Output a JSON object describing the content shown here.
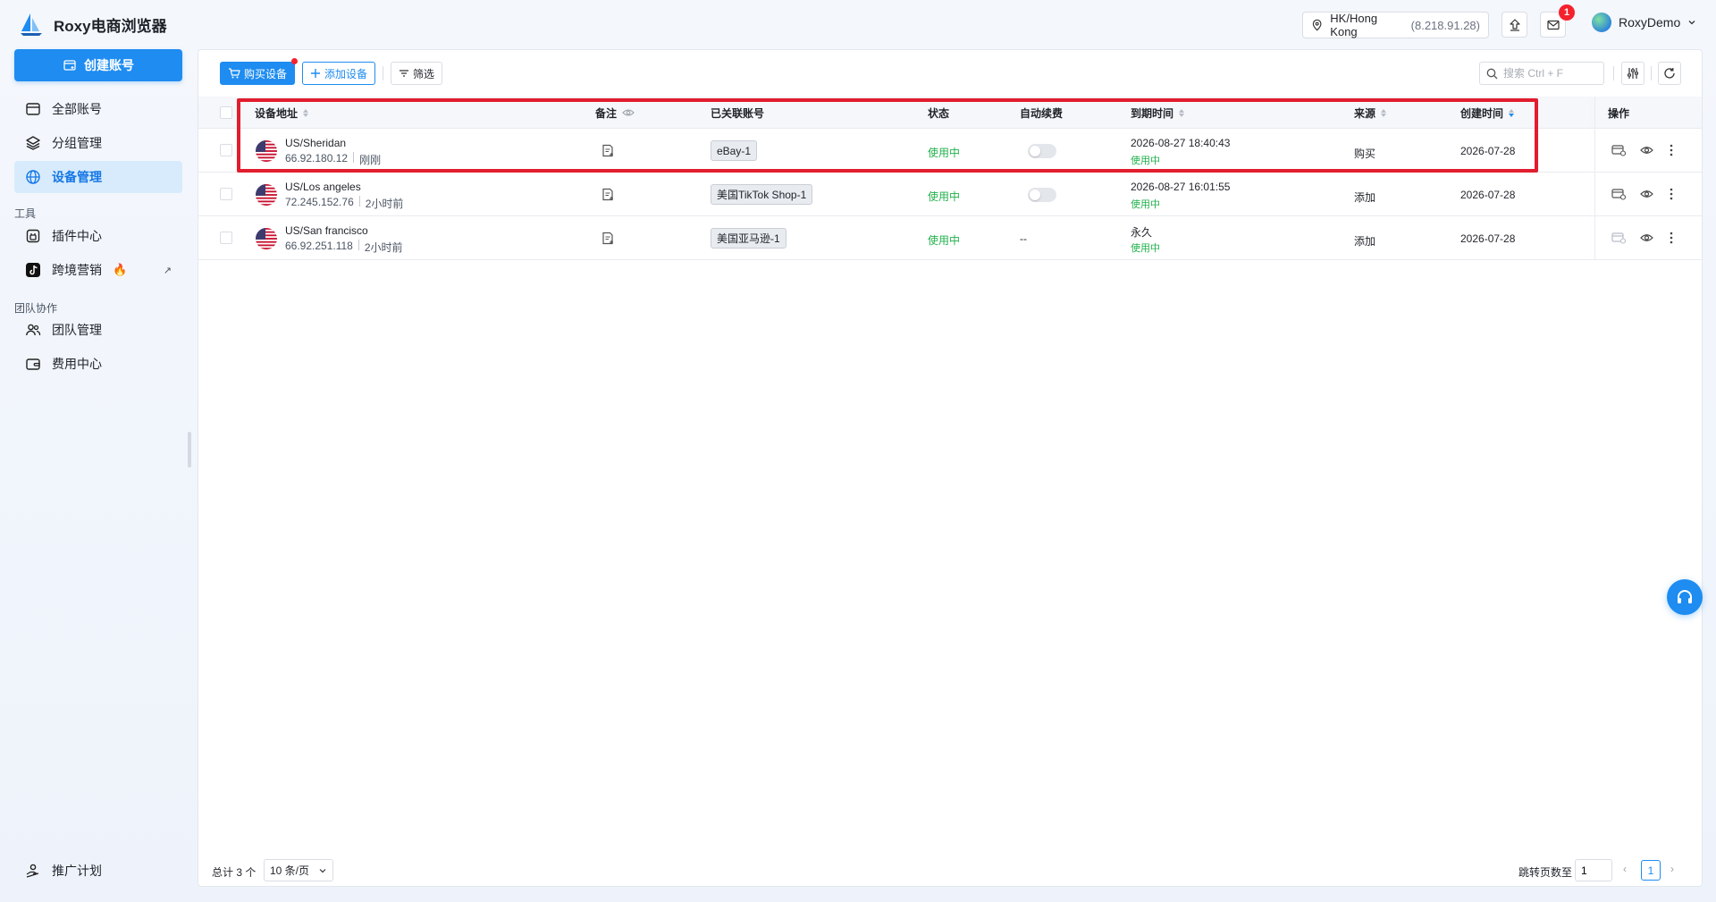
{
  "app": {
    "title": "Roxy电商浏览器"
  },
  "topbar": {
    "location": "HK/Hong Kong",
    "ip": "(8.218.91.28)",
    "notification_count": "1",
    "username": "RoxyDemo"
  },
  "sidebar": {
    "create_label": "创建账号",
    "items": [
      {
        "label": "全部账号"
      },
      {
        "label": "分组管理"
      },
      {
        "label": "设备管理"
      }
    ],
    "tools_group": "工具",
    "tools": [
      {
        "label": "插件中心"
      },
      {
        "label": "跨境营销"
      }
    ],
    "team_group": "团队协作",
    "team": [
      {
        "label": "团队管理"
      },
      {
        "label": "费用中心"
      }
    ],
    "promo_label": "推广计划"
  },
  "toolbar": {
    "buy_label": "购买设备",
    "add_label": "添加设备",
    "filter_label": "筛选",
    "search_placeholder": "搜索 Ctrl + F"
  },
  "table": {
    "headers": {
      "address": "设备地址",
      "note": "备注",
      "linked": "已关联账号",
      "status": "状态",
      "auto_renew": "自动续费",
      "expire": "到期时间",
      "source": "来源",
      "created": "创建时间",
      "ops": "操作"
    },
    "rows": [
      {
        "location": "US/Sheridan",
        "ip": "66.92.180.12",
        "ago": "刚刚",
        "account": "eBay-1",
        "status": "使用中",
        "auto_renew": "toggle",
        "expire": "2026-08-27 18:40:43",
        "expire_status": "使用中",
        "source": "购买",
        "created": "2026-07-28"
      },
      {
        "location": "US/Los angeles",
        "ip": "72.245.152.76",
        "ago": "2小时前",
        "account": "美国TikTok Shop-1",
        "status": "使用中",
        "auto_renew": "toggle",
        "expire": "2026-08-27 16:01:55",
        "expire_status": "使用中",
        "source": "添加",
        "created": "2026-07-28"
      },
      {
        "location": "US/San francisco",
        "ip": "66.92.251.118",
        "ago": "2小时前",
        "account": "美国亚马逊-1",
        "status": "使用中",
        "auto_renew": "--",
        "expire": "永久",
        "expire_status": "使用中",
        "source": "添加",
        "created": "2026-07-28"
      }
    ]
  },
  "footer": {
    "total": "总计 3 个",
    "page_size": "10 条/页",
    "jump_label": "跳转页数至",
    "jump_value": "1",
    "current_page": "1"
  },
  "colors": {
    "accent": "#1e8cf0",
    "success": "#22b14c",
    "alert": "#e11d2e"
  }
}
